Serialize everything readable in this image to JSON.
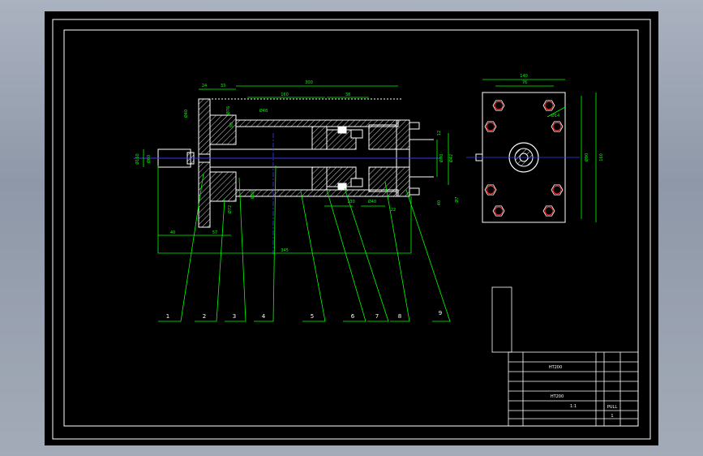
{
  "drawing": {
    "dimensions_front": [
      "24",
      "33",
      "300",
      "160",
      "38",
      "Ø40",
      "Ø160",
      "Ø60",
      "Ø76",
      "90",
      "Ø48",
      "Ø80",
      "Ø72",
      "12",
      "40",
      "Ø70",
      "Ø42",
      "Ø7",
      "130",
      "Ø40",
      "22",
      "345",
      "40",
      "57"
    ],
    "dimensions_side": [
      "140",
      "76",
      "Ø14",
      "Ø90",
      "160"
    ],
    "part_balloons": [
      "1",
      "2",
      "3",
      "4",
      "5",
      "6",
      "7",
      "8",
      "9"
    ],
    "title_block": {
      "main_label": "HT200",
      "material": "HT200",
      "scale": "1:1",
      "sheet": "1",
      "drawing_title": "PULL"
    }
  },
  "colors": {
    "background": "#000000",
    "outline": "#ffffff",
    "dimension": "#00ff00",
    "centerline": "#3a3aff",
    "hatch": "#ffffff",
    "bolt": "#ff3030"
  }
}
